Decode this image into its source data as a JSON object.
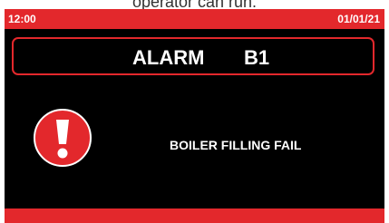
{
  "caption": {
    "text": "operator can run."
  },
  "status_bar": {
    "time": "12:00",
    "date": "01/01/21"
  },
  "alarm": {
    "label": "ALARM",
    "code": "B1",
    "icon": "exclamation-alert-icon",
    "message": "BOILER FILLING FAIL"
  },
  "colors": {
    "accent_red": "#e3282c",
    "screen_background": "#000000",
    "text": "#ffffff"
  }
}
